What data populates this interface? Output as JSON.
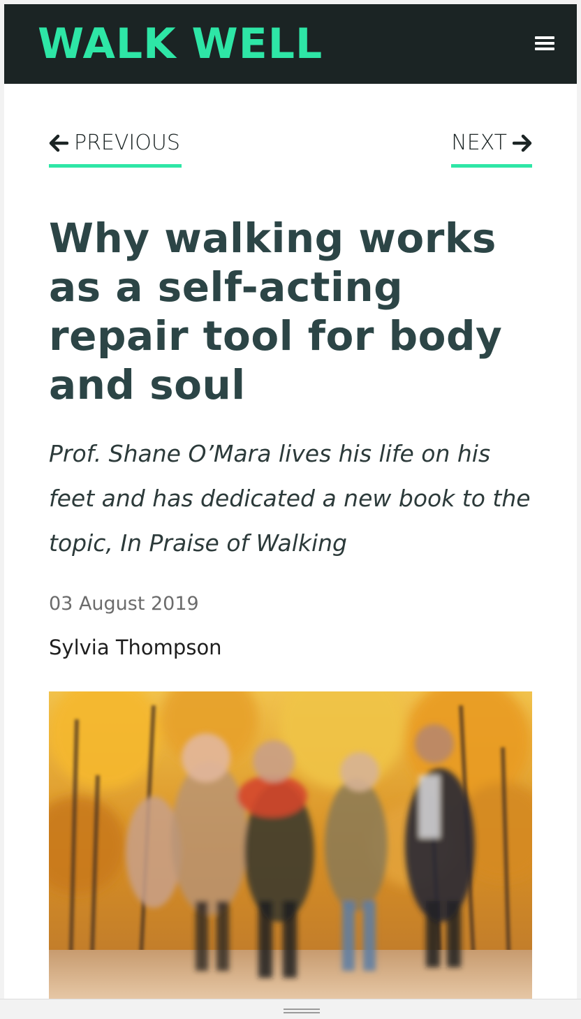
{
  "header": {
    "logo": "WALK WELL",
    "menu_icon": "hamburger-menu-icon",
    "background_color": "#1b2424",
    "brand_color": "#2ee6a6"
  },
  "article_nav": {
    "previous_label": "PREVIOUS",
    "next_label": "NEXT",
    "previous_icon": "arrow-left-icon",
    "next_icon": "arrow-right-icon",
    "underline_color": "#2ee6a6"
  },
  "article": {
    "title": "Why walking works as a self-acting repair tool for body and soul",
    "standfirst": "Prof. Shane O’Mara lives his life on his feet and has dedicated a new book to the topic, In Praise of Walking",
    "date": "03 August 2019",
    "author": "Sylvia Thompson",
    "title_color": "#2c4546"
  },
  "hero_image": {
    "description_icon": "photo-people-walking-autumn-avenue"
  }
}
